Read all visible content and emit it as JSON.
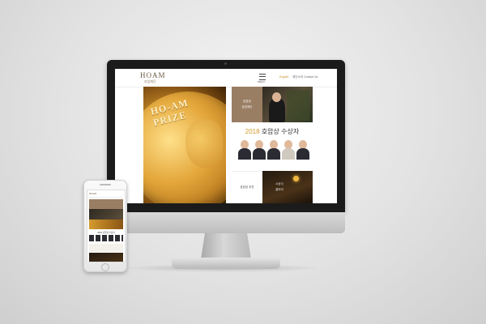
{
  "site": {
    "logo": "HOAM",
    "logo_sub": "호암재단",
    "menu_label": "MENU",
    "lang_english": "English",
    "lang_site": "재단소개",
    "lang_contact": "Contact Us"
  },
  "hero": {
    "medal_line1": "HO-AM",
    "medal_line2": "PRIZE"
  },
  "tiles": {
    "brown_line1": "호암상",
    "brown_line2": "호암재단",
    "winners_year": "2018",
    "winners_title": "호암상 수상자",
    "recommend_label": "호암상 추천",
    "ceremony_line1": "시상식",
    "ceremony_line2": "갤러리"
  },
  "phone": {
    "logo": "HOAM",
    "winners_title": "2018 호암상 수상자"
  },
  "colors": {
    "accent_gold": "#d49a2a",
    "tile_brown": "#9a7e63",
    "bezel": "#1b1b1b"
  }
}
